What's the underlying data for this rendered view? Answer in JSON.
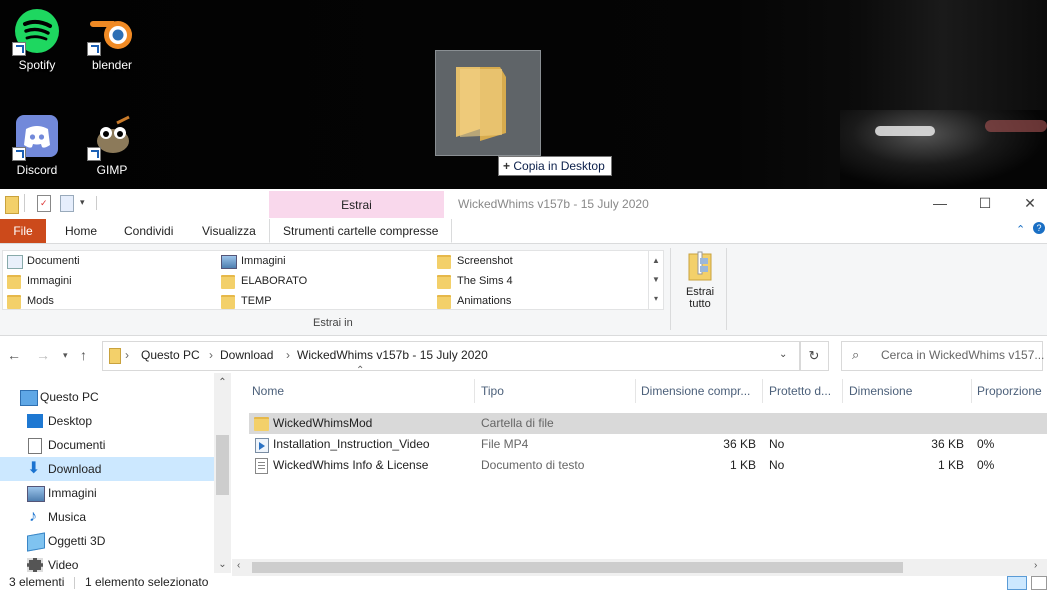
{
  "desktop": {
    "icons": [
      {
        "label": "Spotify",
        "icon": "spotify-icon"
      },
      {
        "label": "blender",
        "icon": "blender-icon"
      },
      {
        "label": "Discord",
        "icon": "discord-icon"
      },
      {
        "label": "GIMP",
        "icon": "gimp-icon"
      }
    ],
    "drag_tooltip": {
      "plus": "+",
      "text": "Copia in Desktop"
    }
  },
  "window": {
    "title": "WickedWhims v157b - 15 July 2020",
    "context_tab_label": "Estrai",
    "minimize": "—",
    "maximize": "☐",
    "close": "✕"
  },
  "ribbon": {
    "tabs": [
      "File",
      "Home",
      "Condividi",
      "Visualizza",
      "Strumenti cartelle compresse"
    ],
    "gallery": {
      "columns": [
        [
          "Documenti",
          "Immagini",
          "Mods"
        ],
        [
          "Immagini",
          "ELABORATO",
          "TEMP"
        ],
        [
          "Screenshot",
          "The Sims 4",
          "Animations"
        ]
      ]
    },
    "group_label": "Estrai in",
    "extract_all_line1": "Estrai",
    "extract_all_line2": "tutto"
  },
  "address": {
    "breadcrumbs": [
      "Questo PC",
      "Download",
      "WickedWhims v157b - 15 July 2020"
    ],
    "search_placeholder": "Cerca in WickedWhims v157..."
  },
  "nav": {
    "items": [
      "Questo PC",
      "Desktop",
      "Documenti",
      "Download",
      "Immagini",
      "Musica",
      "Oggetti 3D",
      "Video"
    ],
    "selected": "Download"
  },
  "columns": [
    "Nome",
    "Tipo",
    "Dimensione compr...",
    "Protetto d...",
    "Dimensione",
    "Proporzione"
  ],
  "files": [
    {
      "name": "WickedWhimsMod",
      "type": "Cartella di file",
      "compressed": "",
      "protected": "",
      "size": "",
      "ratio": "",
      "icon": "folder-icon"
    },
    {
      "name": "Installation_Instruction_Video",
      "type": "File MP4",
      "compressed": "36 KB",
      "protected": "No",
      "size": "36 KB",
      "ratio": "0%",
      "icon": "video-file-icon"
    },
    {
      "name": "WickedWhims Info & License",
      "type": "Documento di testo",
      "compressed": "1 KB",
      "protected": "No",
      "size": "1 KB",
      "ratio": "0%",
      "icon": "text-file-icon"
    }
  ],
  "status": {
    "count": "3 elementi",
    "selection": "1 elemento selezionato"
  },
  "colors": {
    "accent_file_tab": "#cc4a1b",
    "context_tab": "#f9d8ec",
    "selection": "#cce8ff",
    "folder": "#f3d06a"
  }
}
